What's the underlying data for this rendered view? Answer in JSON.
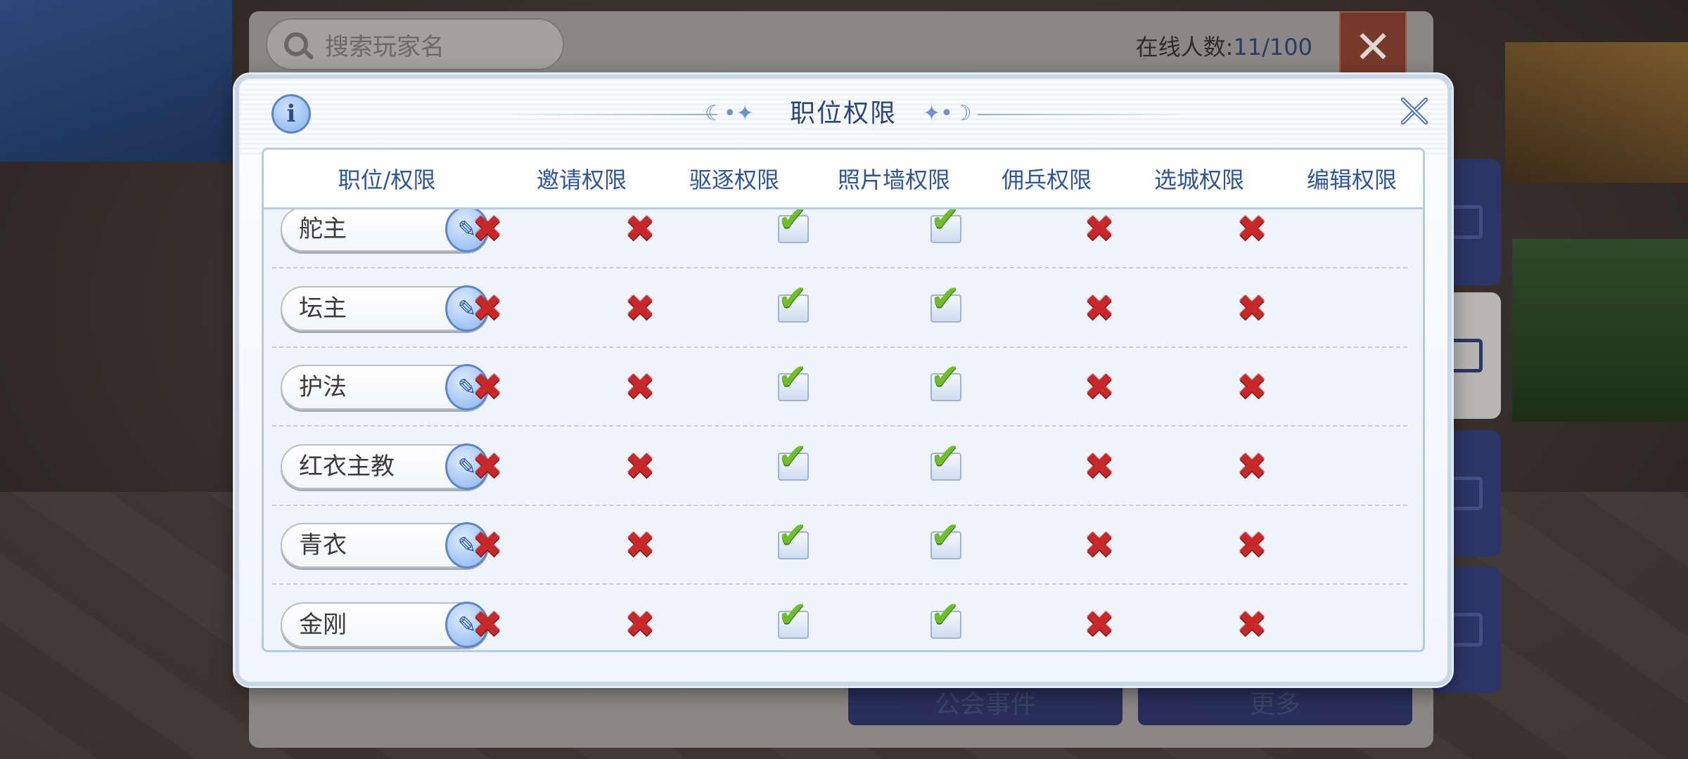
{
  "background": {
    "search": {
      "placeholder": "搜索玩家名"
    },
    "online": {
      "label": "在线人数:",
      "value": "11/100"
    },
    "close_glyph": "✕",
    "bottom_buttons": [
      "公会事件",
      "更多"
    ]
  },
  "modal": {
    "title": "职位权限",
    "info_glyph": "i",
    "title_deco_left": "☾•✦",
    "title_deco_right": "✦•☽",
    "columns": [
      "职位/权限",
      "邀请权限",
      "驱逐权限",
      "照片墙权限",
      "佣兵权限",
      "选城权限",
      "编辑权限"
    ],
    "rows": [
      {
        "role": "舵主",
        "perms": [
          false,
          false,
          true,
          true,
          false,
          false
        ]
      },
      {
        "role": "坛主",
        "perms": [
          false,
          false,
          true,
          true,
          false,
          false
        ]
      },
      {
        "role": "护法",
        "perms": [
          false,
          false,
          true,
          true,
          false,
          false
        ]
      },
      {
        "role": "红衣主教",
        "perms": [
          false,
          false,
          true,
          true,
          false,
          false
        ]
      },
      {
        "role": "青衣",
        "perms": [
          false,
          false,
          true,
          true,
          false,
          false
        ]
      },
      {
        "role": "金刚",
        "perms": [
          false,
          false,
          true,
          true,
          false,
          false
        ]
      }
    ],
    "glyphs": {
      "cross": "✖",
      "check": "✔",
      "edit": "✎"
    }
  },
  "colors": {
    "header_text": "#2f5597",
    "cross": "#c8282a",
    "check": "#6ebf2a"
  }
}
